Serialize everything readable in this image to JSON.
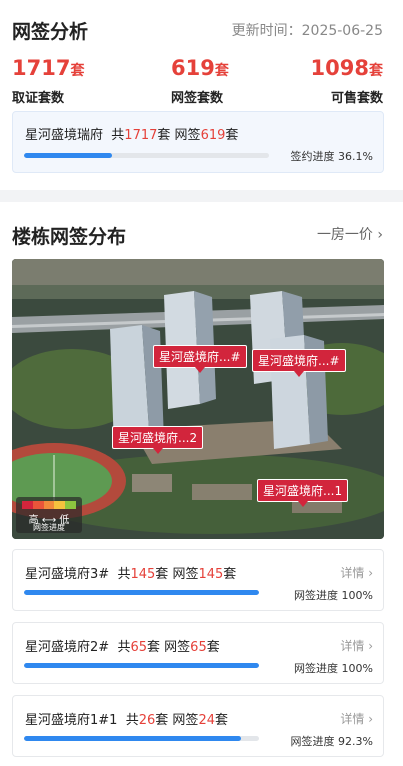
{
  "summary": {
    "title": "网签分析",
    "update_time": "更新时间：2025-06-25",
    "stats": [
      {
        "value": "1717",
        "unit": "套",
        "label": "取证套数"
      },
      {
        "value": "619",
        "unit": "套",
        "label": "网签套数"
      },
      {
        "value": "1098",
        "unit": "套",
        "label": "可售套数"
      }
    ],
    "project": {
      "name": "星河盛境瑞府",
      "total_prefix": "共",
      "total": "1717",
      "total_unit": "套",
      "signed_prefix": "网签",
      "signed": "619",
      "signed_unit": "套",
      "progress_text": "签约进度 36.1%",
      "progress": 0.361
    }
  },
  "distribution": {
    "title": "楼栋网签分布",
    "link": "一房一价 ›",
    "tags": [
      "星河盛境府...#",
      "星河盛境府...#",
      "星河盛境府...2",
      "星河盛境府...1"
    ],
    "legend": {
      "high_low": "高 ⟷ 低",
      "label": "网签进度",
      "colors": [
        "#d2253c",
        "#e8553a",
        "#f08a3c",
        "#f4c23e",
        "#8cc63f"
      ]
    },
    "buildings": [
      {
        "name": "星河盛境府3#",
        "total_prefix": "共",
        "total": "145",
        "unit": "套",
        "signed_prefix": "网签",
        "signed": "145",
        "detail": "详情 ›",
        "progress_text": "网签进度 100%",
        "progress": 1.0
      },
      {
        "name": "星河盛境府2#",
        "total_prefix": "共",
        "total": "65",
        "unit": "套",
        "signed_prefix": "网签",
        "signed": "65",
        "detail": "详情 ›",
        "progress_text": "网签进度 100%",
        "progress": 1.0
      },
      {
        "name": "星河盛境府1#1",
        "total_prefix": "共",
        "total": "26",
        "unit": "套",
        "signed_prefix": "网签",
        "signed": "24",
        "detail": "详情 ›",
        "progress_text": "网签进度 92.3%",
        "progress": 0.923
      }
    ]
  }
}
